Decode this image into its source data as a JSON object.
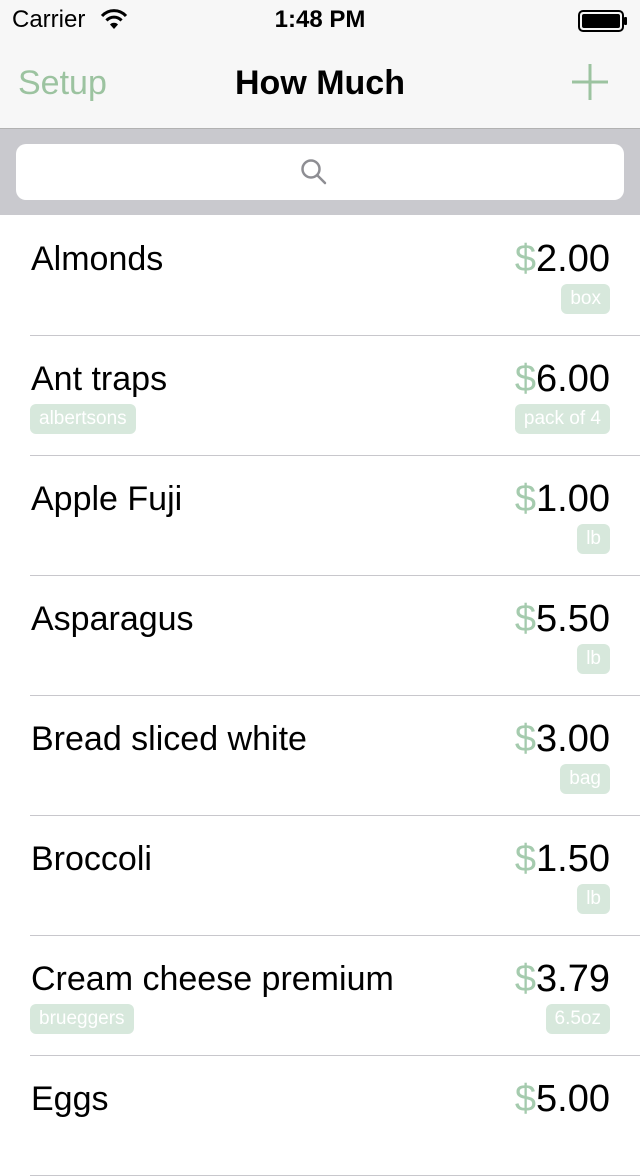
{
  "status_bar": {
    "carrier": "Carrier",
    "time": "1:48 PM"
  },
  "nav": {
    "left_button": "Setup",
    "title": "How Much",
    "add_icon": "plus-icon"
  },
  "search": {
    "placeholder": "",
    "icon": "search-icon"
  },
  "colors": {
    "accent": "#9cc3a0",
    "tag_bg": "#d7e8dc",
    "dollar": "#a5cbae"
  },
  "items": [
    {
      "name": "Almonds",
      "currency": "$",
      "amount": "2.00",
      "unit": "box",
      "store": ""
    },
    {
      "name": "Ant traps",
      "currency": "$",
      "amount": "6.00",
      "unit": "pack of 4",
      "store": "albertsons"
    },
    {
      "name": "Apple Fuji",
      "currency": "$",
      "amount": "1.00",
      "unit": "lb",
      "store": ""
    },
    {
      "name": "Asparagus",
      "currency": "$",
      "amount": "5.50",
      "unit": "lb",
      "store": ""
    },
    {
      "name": "Bread sliced white",
      "currency": "$",
      "amount": "3.00",
      "unit": "bag",
      "store": ""
    },
    {
      "name": "Broccoli",
      "currency": "$",
      "amount": "1.50",
      "unit": "lb",
      "store": ""
    },
    {
      "name": "Cream cheese premium",
      "currency": "$",
      "amount": "3.79",
      "unit": "6.5oz",
      "store": "brueggers"
    },
    {
      "name": "Eggs",
      "currency": "$",
      "amount": "5.00",
      "unit": "",
      "store": ""
    }
  ]
}
